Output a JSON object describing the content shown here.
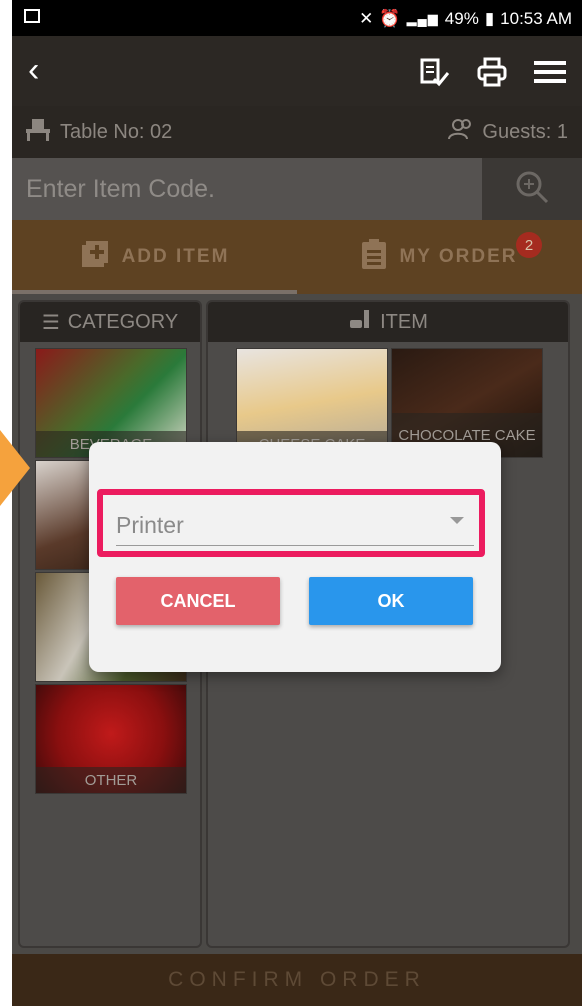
{
  "status_bar": {
    "battery": "49%",
    "time": "10:53 AM"
  },
  "toolbar": {
    "back_icon": "back-icon",
    "icons": [
      "bill-check-icon",
      "printer-icon",
      "menu-icon"
    ]
  },
  "table_info": {
    "table": "Table No: 02",
    "guests": "Guests: 1"
  },
  "search": {
    "placeholder": "Enter Item Code."
  },
  "tabs": [
    {
      "label": "ADD ITEM"
    },
    {
      "label": "MY ORDER",
      "badge": "2"
    }
  ],
  "panels": {
    "category_title": "CATEGORY",
    "item_title": "ITEM",
    "categories": [
      {
        "label": "BEVERAGE"
      },
      {
        "label": ""
      },
      {
        "label": ""
      },
      {
        "label": "OTHER"
      }
    ],
    "items": [
      {
        "label": "CHEESE CAKE"
      },
      {
        "label": "CHOCOLATE CAKE"
      }
    ]
  },
  "confirm": {
    "label": "CONFIRM ORDER"
  },
  "dialog": {
    "select_value": "Printer",
    "cancel_label": "CANCEL",
    "ok_label": "OK"
  },
  "colors": {
    "highlight": "#ec1c5f",
    "ok": "#2996ec",
    "cancel": "#e3626b",
    "callout_arrow": "#f5a23d"
  }
}
